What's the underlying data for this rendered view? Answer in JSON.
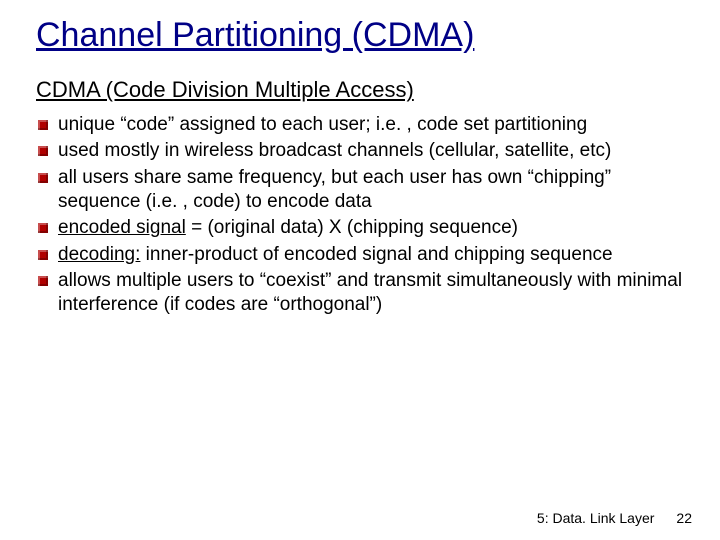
{
  "title": "Channel Partitioning (CDMA)",
  "subtitle": "CDMA (Code Division Multiple Access)",
  "bullets": [
    {
      "pre": "unique “code” assigned to each user; i.e. , code set partitioning"
    },
    {
      "pre": "used mostly in wireless broadcast channels (cellular, satellite, etc)"
    },
    {
      "pre": "all users share same frequency, but each user has own “chipping” sequence (i.e. , code) to encode data"
    },
    {
      "u": "encoded signal",
      "post": " = (original data) X (chipping sequence)"
    },
    {
      "u": "decoding:",
      "post": " inner-product of encoded signal and chipping sequence"
    },
    {
      "pre": "allows multiple users to “coexist” and transmit simultaneously with minimal interference (if codes are “orthogonal”)"
    }
  ],
  "footer": {
    "text": "5: Data. Link Layer",
    "page": "22"
  }
}
